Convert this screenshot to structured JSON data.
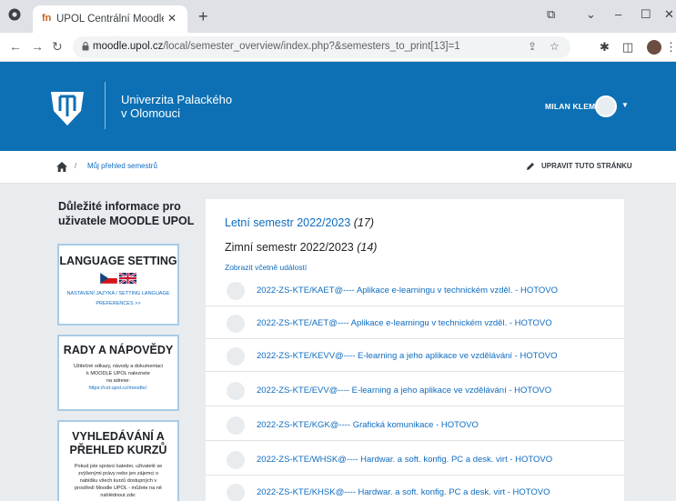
{
  "browser": {
    "tab_title": "UPOL Centrální Moodle: Přehled",
    "tab_favicon": "fn",
    "url_host": "moodle.upol.cz",
    "url_path": "/local/semester_overview/index.php?&semesters_to_print[13]=1"
  },
  "header": {
    "university_line1": "Univerzita Palackého",
    "university_line2": "v Olomouci",
    "user_name": "MILAN KLEMENT"
  },
  "breadcrumb": {
    "separator": "/",
    "current": "Můj přehled semestrů",
    "edit_label": "UPRAVIT TUTO STRÁNKU"
  },
  "sidebar": {
    "title": "Důležité informace pro uživatele MOODLE UPOL",
    "language_block": {
      "heading": "LANGUAGE SETTING",
      "link_line1": "NASTAVENÍ JAZYKA / SETTING LANGUAGE",
      "link_line2": "PREFERENCES >>"
    },
    "help_block": {
      "heading": "RADY A NÁPOVĚDY",
      "text_line1": "Užitečné odkazy, návody a dokumentaci",
      "text_line2": "k MOODLE UPOL naleznete",
      "text_line3": "na adrese:",
      "link": "https://cvt.upol.cz/moodle/."
    },
    "search_block": {
      "heading_line1": "VYHLEDÁVÁNÍ A",
      "heading_line2": "PŘEHLED KURZŮ",
      "text_line1": "Pokud jste správci kateder, uživatelé se",
      "text_line2": "zvýšenými právy nebo jen zájemci o",
      "text_line3": "nabídku všech kurzů dostupných v",
      "text_line4": "prostředí Moodle UPOL - můžete na ně",
      "text_line5": "nahlédnout zde:"
    }
  },
  "main": {
    "summer_semester": "Letní semestr 2022/2023",
    "summer_count": "(17)",
    "winter_semester": "Zimní semestr 2022/2023",
    "winter_count": "(14)",
    "events_link": "Zobrazit včetně událostí",
    "courses": [
      "2022-ZS-KTE/KAET@---- Aplikace e-learningu v technickém vzděl. - HOTOVO",
      "2022-ZS-KTE/AET@---- Aplikace e-learningu v technickém vzděl. - HOTOVO",
      "2022-ZS-KTE/KEVV@---- E-learning a jeho aplikace ve vzdělávání - HOTOVO",
      "2022-ZS-KTE/EVV@---- E-learning a jeho aplikace ve vzdělávání - HOTOVO",
      "2022-ZS-KTE/KGK@---- Grafická komunikace - HOTOVO",
      "2022-ZS-KTE/WHSK@---- Hardwar. a soft. konfig. PC a desk. virt - HOTOVO",
      "2022-ZS-KTE/KHSK@---- Hardwar. a soft. konfig. PC a desk. virt - HOTOVO"
    ]
  },
  "colors": {
    "brand_blue": "#0d70b4",
    "link_blue": "#0f6cbf",
    "block_border": "#a9cbe5"
  }
}
